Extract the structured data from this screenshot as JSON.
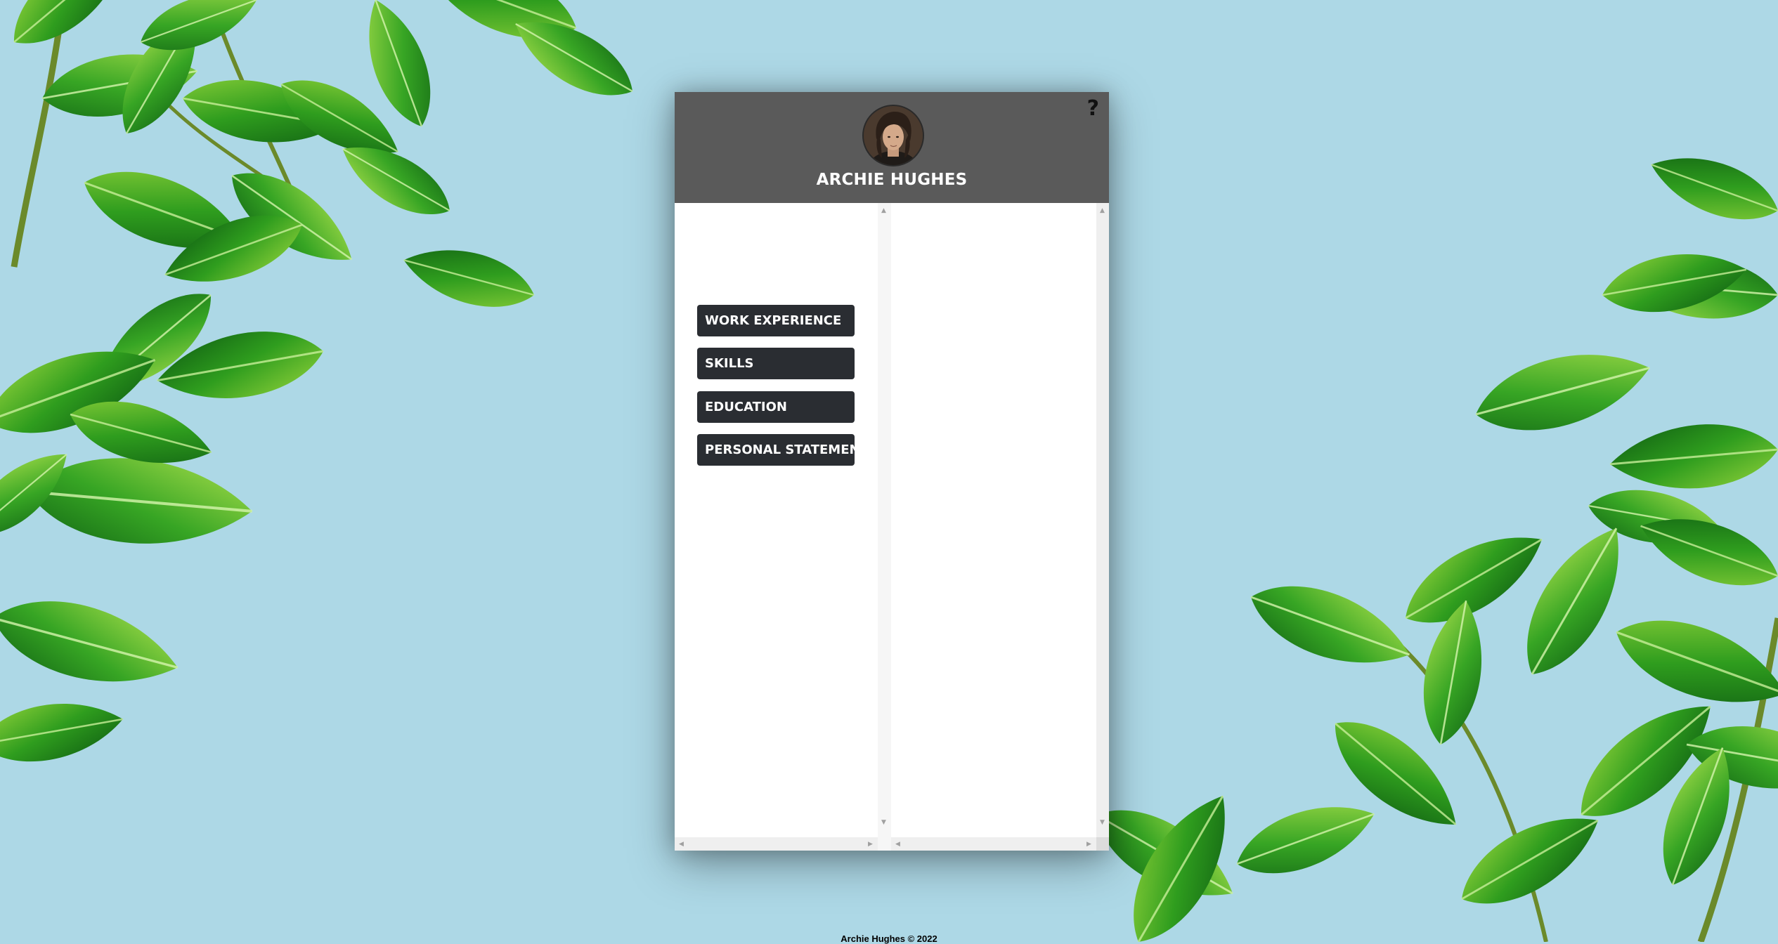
{
  "profile": {
    "name": "ARCHIE HUGHES",
    "help_label": "?"
  },
  "nav": {
    "items": [
      {
        "label": "WORK EXPERIENCE"
      },
      {
        "label": "SKILLS"
      },
      {
        "label": "EDUCATION"
      },
      {
        "label": "PERSONAL STATEMENT"
      }
    ]
  },
  "footer": {
    "text": "Archie Hughes © 2022"
  },
  "colors": {
    "background": "#add8e6",
    "header": "#5a5a5a",
    "button": "#2a2d32",
    "leaf": "#2e9b1c"
  },
  "icons": {
    "help": "question-mark-icon",
    "avatar": "profile-photo"
  }
}
